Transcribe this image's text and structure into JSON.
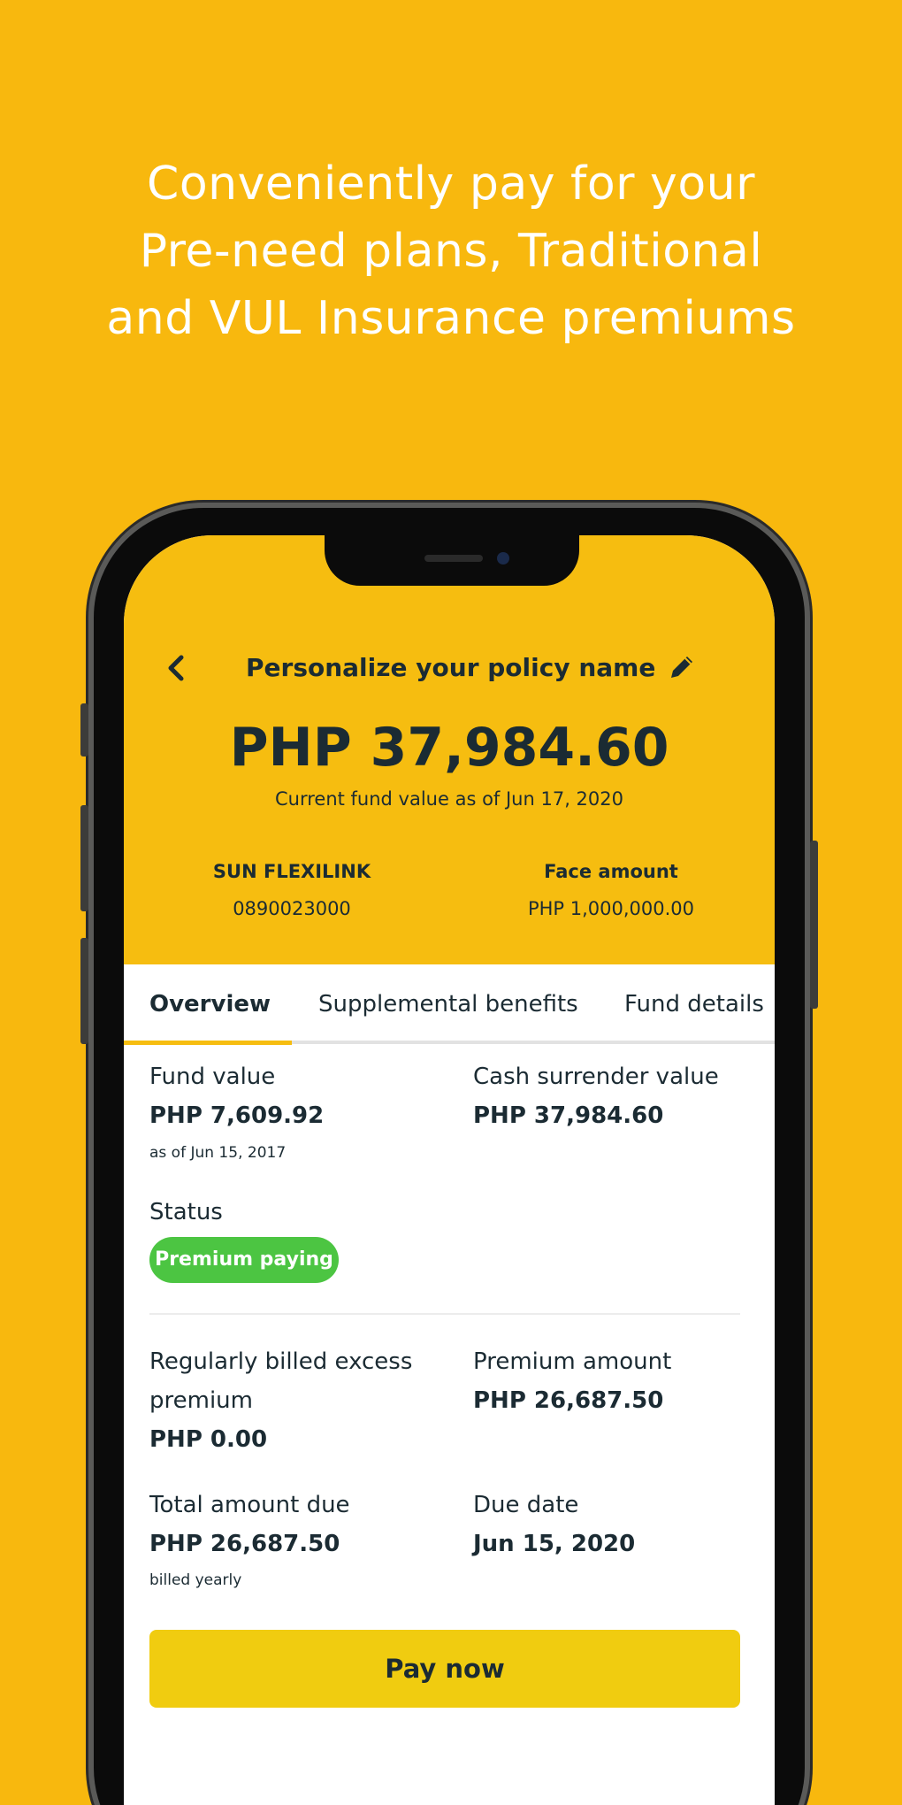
{
  "promo": {
    "line1": "Conveniently pay for your",
    "line2": "Pre-need plans, Traditional",
    "line3": "and VUL Insurance premiums"
  },
  "header": {
    "back_icon": "chevron-left-icon",
    "title": "Personalize your policy name",
    "edit_icon": "pencil-icon",
    "fund_amount": "PHP 37,984.60",
    "fund_caption": "Current fund value as of Jun 17, 2020",
    "plan_name": "SUN FLEXILINK",
    "policy_number": "0890023000",
    "face_amount_label": "Face amount",
    "face_amount_value": "PHP 1,000,000.00"
  },
  "tabs": [
    {
      "label": "Overview",
      "active": true
    },
    {
      "label": "Supplemental benefits",
      "active": false
    },
    {
      "label": "Fund details",
      "active": false
    }
  ],
  "overview": {
    "fund_value_label": "Fund value",
    "fund_value": "PHP 7,609.92",
    "fund_value_note": "as of Jun 15, 2017",
    "cash_surrender_label": "Cash surrender value",
    "cash_surrender_value": "PHP 37,984.60",
    "status_label": "Status",
    "status_value": "Premium paying",
    "excess_premium_label_line1": "Regularly billed excess",
    "excess_premium_label_line2": "premium",
    "excess_premium_value": "PHP 0.00",
    "premium_amount_label": "Premium amount",
    "premium_amount_value": "PHP 26,687.50",
    "total_due_label": "Total amount due",
    "total_due_value": "PHP 26,687.50",
    "total_due_note": "billed yearly",
    "due_date_label": "Due date",
    "due_date_value": "Jun 15, 2020"
  },
  "actions": {
    "pay_now_label": "Pay now"
  },
  "colors": {
    "background": "#f8b80e",
    "header": "#f6bd10",
    "status_green": "#4cc542",
    "pay_button": "#f0cc10",
    "text_dark": "#1b2b33"
  }
}
